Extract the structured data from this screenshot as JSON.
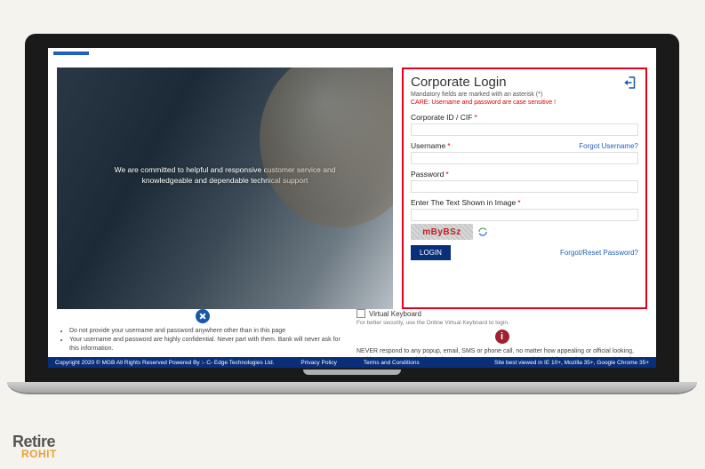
{
  "hero": {
    "line1": "We are committed to helpful and responsive customer service and",
    "line2": "knowledgeable and dependable technical support"
  },
  "login": {
    "title": "Corporate Login",
    "mandatory_note": "Mandatory fields are marked with an asterisk (*)",
    "care_note": "CARE: Username and password are case sensitive !",
    "corp_label": "Corporate ID / CIF",
    "username_label": "Username",
    "password_label": "Password",
    "captcha_label": "Enter The Text Shown in Image",
    "captcha_text": "mByBSz",
    "forgot_username": "Forgot Username?",
    "forgot_password": "Forgot/Reset Password?",
    "login_btn": "LOGIN"
  },
  "vk": {
    "label": "Virtual Keyboard",
    "sub": "For better security, use the Online Virtual Keyboard to login."
  },
  "tips_left": {
    "item1": "Do not provide your username and password anywhere other than in this page",
    "item2": "Your username and password are highly confidential. Never part with them. Bank will never ask for this information."
  },
  "tips_right": {
    "text": "NEVER respond to any popup, email, SMS or phone call, no matter how appealing or official looking, seeking your personal information such as username, password(s), mobile number, ATM Card details, etc. Such communications are sent or created by"
  },
  "footer": {
    "copyright": "Copyright 2020 © MGB All Rights Reserved   Powered By :- C- Edge Technologies Ltd.",
    "privacy": "Privacy Policy",
    "terms": "Terms and Conditions",
    "browser": "Site best viewed in IE 10+, Mozilla 35+, Google Chrome 35+"
  },
  "brand": {
    "retire": "Retire",
    "rohit": "ROHIT"
  }
}
